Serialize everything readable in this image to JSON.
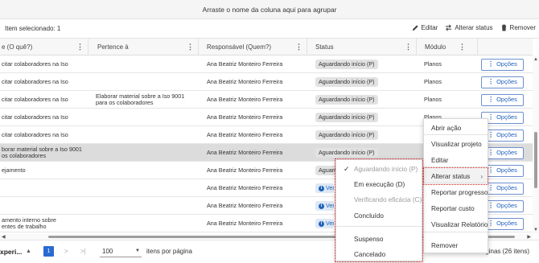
{
  "group_bar": {
    "text": "Arraste o nome da coluna aqui para agrupar"
  },
  "toolbar": {
    "selected_text": "Item selecionado: 1",
    "edit_label": "Editar",
    "change_status_label": "Alterar status",
    "remove_label": "Remover"
  },
  "columns": [
    {
      "label": "e (O quê?)"
    },
    {
      "label": "Pertence à"
    },
    {
      "label": "Responsável (Quem?)"
    },
    {
      "label": "Status"
    },
    {
      "label": "Módulo"
    }
  ],
  "rows": [
    {
      "oque": "citar colaboradores na Iso",
      "pertence": "",
      "responsavel": "Ana Beatriz Monteiro Ferreira",
      "status": "Aguardando início (P)",
      "status_kind": "wait",
      "modulo": "Planos",
      "options_label": "Opções"
    },
    {
      "oque": "citar colaboradores na Iso",
      "pertence": "",
      "responsavel": "Ana Beatriz Monteiro Ferreira",
      "status": "Aguardando início (P)",
      "status_kind": "wait",
      "modulo": "Planos",
      "options_label": "Opções"
    },
    {
      "oque": "citar colaboradores na Iso",
      "pertence": "Elaborar material sobre a Iso 9001\npara os colaboradores",
      "responsavel": "Ana Beatriz Monteiro Ferreira",
      "status": "Aguardando início (P)",
      "status_kind": "wait",
      "modulo": "Planos",
      "options_label": "Opções"
    },
    {
      "oque": "citar colaboradores na Iso",
      "pertence": "",
      "responsavel": "Ana Beatriz Monteiro Ferreira",
      "status": "Aguardando início (P)",
      "status_kind": "wait",
      "modulo": "Planos",
      "options_label": "Opções"
    },
    {
      "oque": "citar colaboradores na Iso",
      "pertence": "",
      "responsavel": "Ana Beatriz Monteiro Ferreira",
      "status": "Aguardando início (P)",
      "status_kind": "wait",
      "modulo": "Planos",
      "options_label": "Opções"
    },
    {
      "oque": "borar material sobre a Iso 9001\nos colaboradores",
      "pertence": "",
      "responsavel": "Ana Beatriz Monteiro Ferreira",
      "status": "Aguardando início (P)",
      "status_kind": "wait",
      "modulo": "",
      "options_label": "Opções",
      "selected": true
    },
    {
      "oque": "ejamento",
      "pertence": "",
      "responsavel": "Ana Beatriz Monteiro Ferreira",
      "status": "Aguardando início (P)",
      "status_kind": "wait",
      "modulo": "",
      "options_label": "Opções"
    },
    {
      "oque": "",
      "pertence": "",
      "responsavel": "Ana Beatriz Monteiro Ferreira",
      "status": "Veri",
      "status_kind": "verif",
      "modulo": "",
      "options_label": "Opções"
    },
    {
      "oque": "",
      "pertence": "",
      "responsavel": "Ana Beatriz Monteiro Ferreira",
      "status": "Veri",
      "status_kind": "verif",
      "modulo": "",
      "options_label": "Opções"
    },
    {
      "oque": "amento interno sobre\nentes de trabalho",
      "pertence": "",
      "responsavel": "Ana Beatriz Monteiro Ferreira",
      "status": "Veri",
      "status_kind": "verif",
      "modulo": "",
      "options_label": "Opções"
    }
  ],
  "context_menu": {
    "items": [
      "Abrir ação",
      "Visualizar projeto",
      "Editar",
      "Alterar status",
      "Reportar progresso",
      "Reportar custo",
      "Visualizar Relatório",
      "Remover"
    ],
    "highlighted": "Alterar status"
  },
  "status_submenu": {
    "items": [
      {
        "label": "Aguardando início (P)",
        "disabled": true,
        "checked": true
      },
      {
        "label": "Em execução (D)",
        "disabled": false,
        "checked": false
      },
      {
        "label": "Verificando eficácia (C)",
        "disabled": true,
        "checked": false
      },
      {
        "label": "Concluído",
        "disabled": false,
        "checked": false
      },
      {
        "label": "Suspenso",
        "disabled": false,
        "checked": false
      },
      {
        "label": "Cancelado",
        "disabled": false,
        "checked": false
      }
    ]
  },
  "footer": {
    "left_label": "xperi...",
    "current_page": "1",
    "page_size": "100",
    "per_page_label": "itens por página",
    "count_text": "áginas (26 itens)"
  },
  "colors": {
    "accent": "#2a6ad2",
    "highlight_border": "#d21f1f",
    "selected_row": "#dcdcdc"
  },
  "icons": [
    "pencil-icon",
    "swap-icon",
    "trash-icon",
    "kebab-icon",
    "check-icon",
    "info-icon",
    "chevron-right-icon"
  ]
}
